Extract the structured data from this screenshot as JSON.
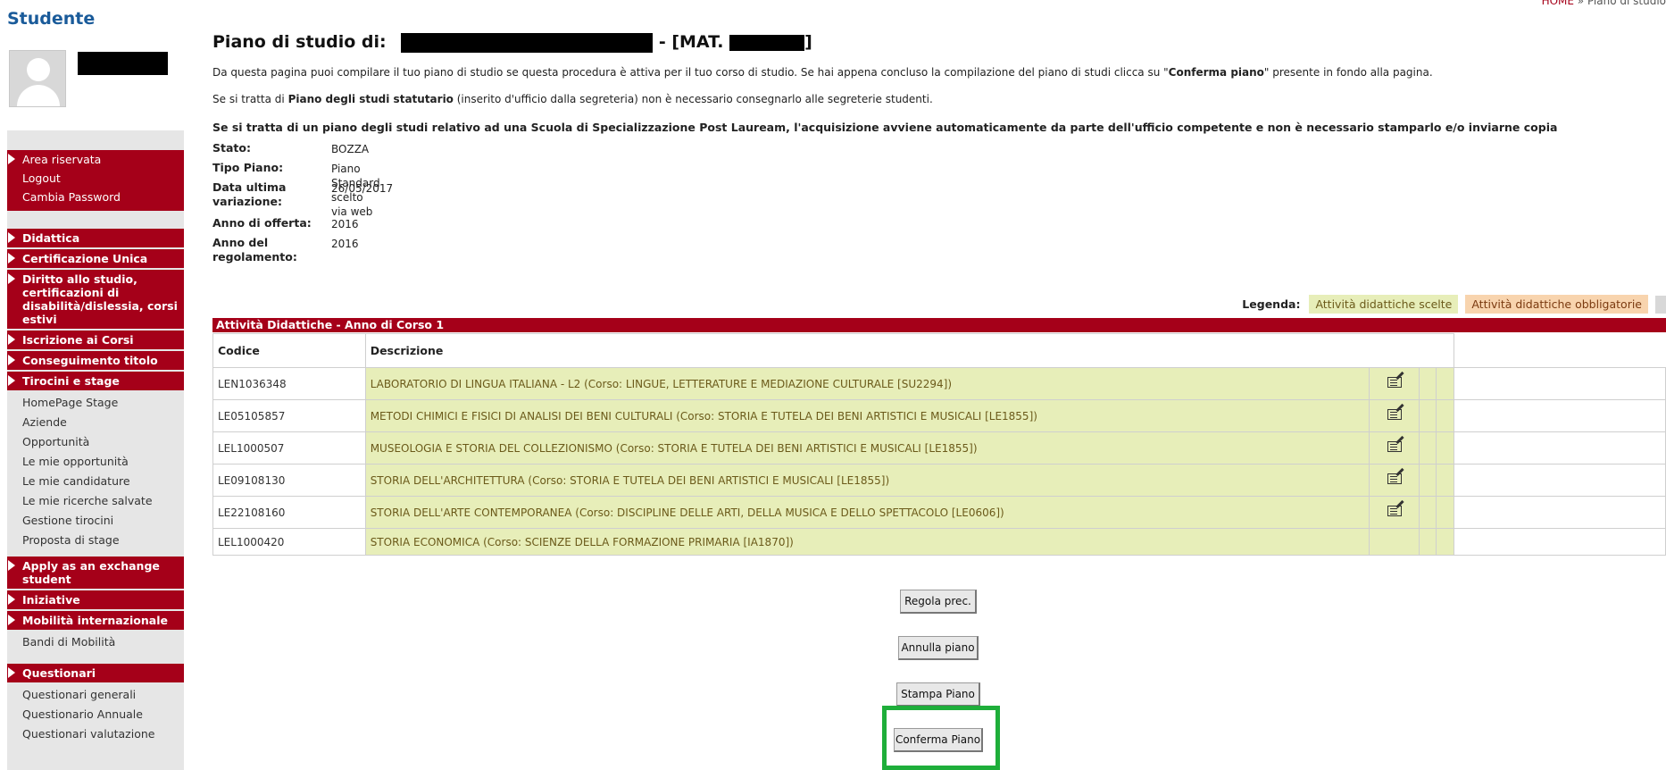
{
  "sidebar": {
    "title": "Studente",
    "user_links": [
      "Area riservata",
      "Logout",
      "Cambia Password"
    ],
    "sections": [
      {
        "label": "Didattica"
      },
      {
        "label": "Certificazione Unica"
      },
      {
        "label": "Diritto allo studio, certificazioni di disabilità/dislessia, corsi estivi"
      },
      {
        "label": "Iscrizione ai Corsi"
      },
      {
        "label": "Conseguimento titolo"
      },
      {
        "label": "Tirocini e stage",
        "sub": [
          "HomePage Stage",
          "Aziende",
          "Opportunità",
          "Le mie opportunità",
          "Le mie candidature",
          "Le mie ricerche salvate",
          "Gestione tirocini",
          "Proposta di stage"
        ]
      },
      {
        "label": "Apply as an exchange student"
      },
      {
        "label": "Iniziative"
      },
      {
        "label": "Mobilità internazionale",
        "sub": [
          "Bandi di Mobilità"
        ]
      },
      {
        "label": "Questionari",
        "sub": [
          "Questionari generali",
          "Questionario Annuale",
          "Questionari valutazione"
        ]
      }
    ]
  },
  "breadcrumb": {
    "home": "HOME",
    "sep": " » ",
    "current": "Piano di studio"
  },
  "title": {
    "prefix": "Piano di studio di:",
    "mid": "- [MAT.",
    "suffix": "]"
  },
  "intro": {
    "p1_a": "Da questa pagina puoi compilare il tuo piano di studio se questa procedura è attiva per il tuo corso di studio. Se hai appena concluso la compilazione del piano di studi clicca su \"",
    "p1_b": "Conferma piano",
    "p1_c": "\" presente in fondo alla pagina.",
    "p2_a": "Se si tratta di ",
    "p2_b": "Piano degli studi statutario",
    "p2_c": " (inserito d'ufficio dalla segreteria) non è necessario consegnarlo alle segreterie studenti.",
    "p3": "Se si tratta di un piano degli studi relativo ad una Scuola di Specializzazione Post Lauream, l'acquisizione avviene automaticamente da parte dell'ufficio competente e non è necessario stamparlo e/o inviarne copia"
  },
  "info": {
    "stato_label": "Stato:",
    "stato": "BOZZA",
    "tipo_label": "Tipo Piano:",
    "tipo": "Piano Standard scelto via web",
    "data_label": "Data ultima variazione:",
    "data": "26/05/2017",
    "anno_offerta_label": "Anno di offerta:",
    "anno_offerta": "2016",
    "anno_reg_label": "Anno del regolamento:",
    "anno_reg": "2016"
  },
  "legend": {
    "title": "Legenda:",
    "green": "Attività didattiche scelte",
    "orange": "Attività didattiche obbligatorie"
  },
  "table": {
    "caption": "Attività Didattiche - Anno di Corso 1",
    "col_code": "Codice",
    "col_desc": "Descrizione",
    "rows": [
      {
        "code": "LEN1036348",
        "desc": "LABORATORIO DI LINGUA ITALIANA - L2 (Corso: LINGUE, LETTERATURE E MEDIAZIONE CULTURALE [SU2294])",
        "edit": true
      },
      {
        "code": "LE05105857",
        "desc": "METODI CHIMICI E FISICI DI ANALISI DEI BENI CULTURALI (Corso: STORIA E TUTELA DEI BENI ARTISTICI E MUSICALI [LE1855])",
        "edit": true
      },
      {
        "code": "LEL1000507",
        "desc": "MUSEOLOGIA E STORIA DEL COLLEZIONISMO (Corso: STORIA E TUTELA DEI BENI ARTISTICI E MUSICALI [LE1855])",
        "edit": true
      },
      {
        "code": "LE09108130",
        "desc": "STORIA DELL'ARCHITETTURA (Corso: STORIA E TUTELA DEI BENI ARTISTICI E MUSICALI [LE1855])",
        "edit": true
      },
      {
        "code": "LE22108160",
        "desc": "STORIA DELL'ARTE CONTEMPORANEA (Corso: DISCIPLINE DELLE ARTI, DELLA MUSICA E DELLO SPETTACOLO [LE0606])",
        "edit": true
      },
      {
        "code": "LEL1000420",
        "desc": "STORIA ECONOMICA (Corso: SCIENZE DELLA FORMAZIONE PRIMARIA [IA1870])",
        "edit": false
      }
    ]
  },
  "buttons": {
    "prev": "Regola prec.",
    "annulla": "Annulla piano",
    "stampa": "Stampa  Piano",
    "conferma": "Conferma Piano"
  },
  "colors": {
    "brand_red": "#a50019",
    "chosen_green": "#e7eeb9",
    "mandatory_orange": "#f8d4ae",
    "highlight_frame": "#1eae3a"
  }
}
